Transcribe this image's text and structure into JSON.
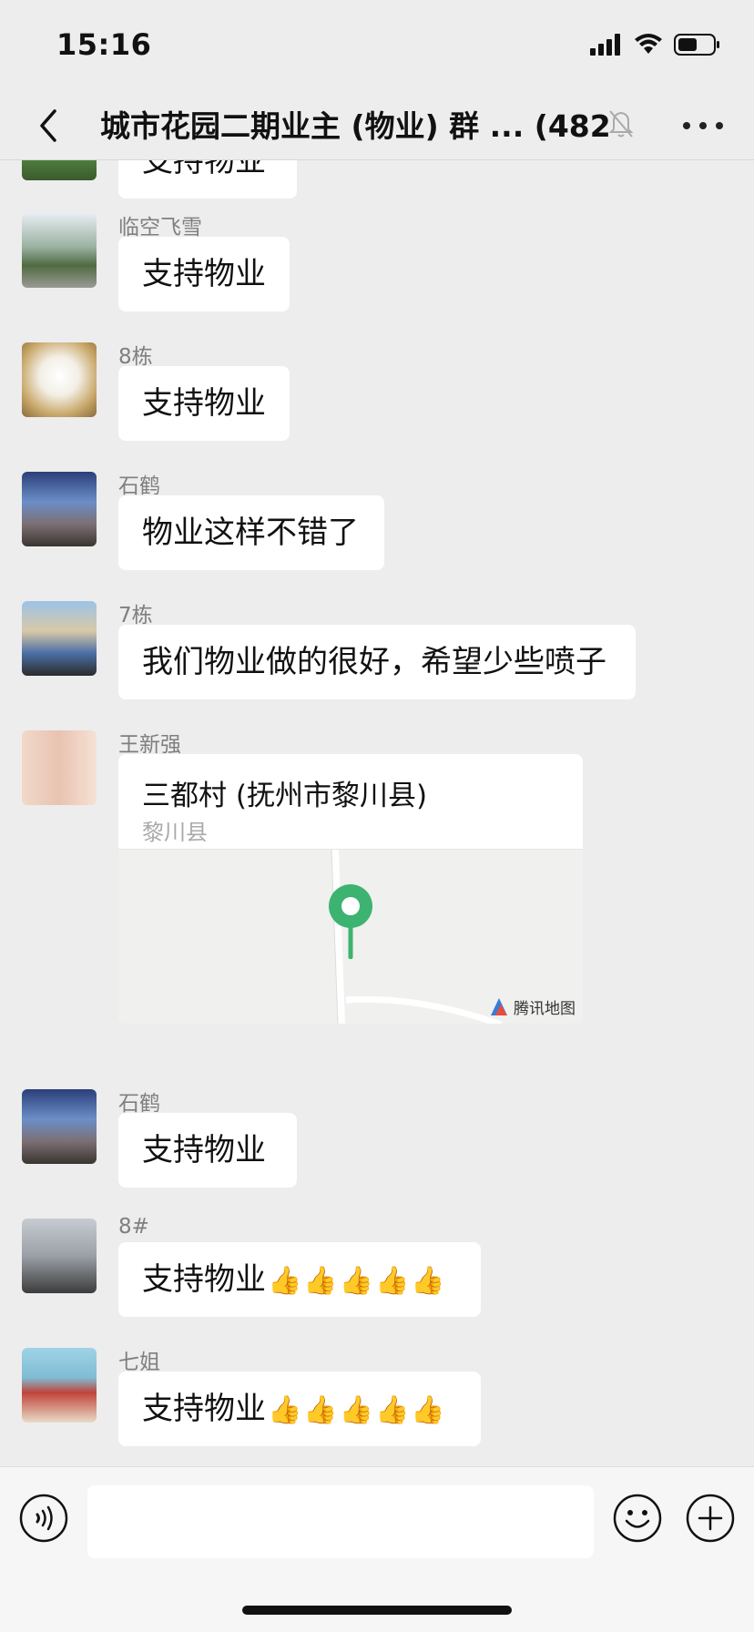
{
  "status_bar": {
    "time": "15:16"
  },
  "header": {
    "back_icon": "chevron-left-icon",
    "title": "城市花园二期业主 (物业) 群 ...",
    "member_count": "(482)",
    "muted_icon": "bell-slash-icon",
    "more_icon": "ellipsis-icon"
  },
  "messages": [
    {
      "sender": "",
      "text": "支持物业"
    },
    {
      "sender": "临空飞雪",
      "text": "支持物业"
    },
    {
      "sender": "8栋",
      "text": "支持物业"
    },
    {
      "sender": "石鹤",
      "text": "物业这样不错了"
    },
    {
      "sender": "7栋",
      "text": "我们物业做的很好，希望少些喷子"
    },
    {
      "sender": "王新强",
      "location": {
        "title": "三都村 (抚州市黎川县)",
        "subtitle": "黎川县",
        "map_brand": "腾讯地图"
      }
    },
    {
      "sender": "石鹤",
      "text": "支持物业"
    },
    {
      "sender": "8#",
      "text": "支持物业",
      "emoji": "👍👍👍👍👍"
    },
    {
      "sender": "七姐",
      "text": "支持物业",
      "emoji": "👍👍👍👍👍"
    }
  ],
  "input_bar": {
    "voice_icon": "voice-icon",
    "emoji_icon": "emoji-icon",
    "plus_icon": "plus-icon",
    "input_value": ""
  },
  "colors": {
    "background": "#ededed",
    "bubble": "#ffffff",
    "pin": "#3cb371",
    "sender": "#7f7f7f"
  }
}
